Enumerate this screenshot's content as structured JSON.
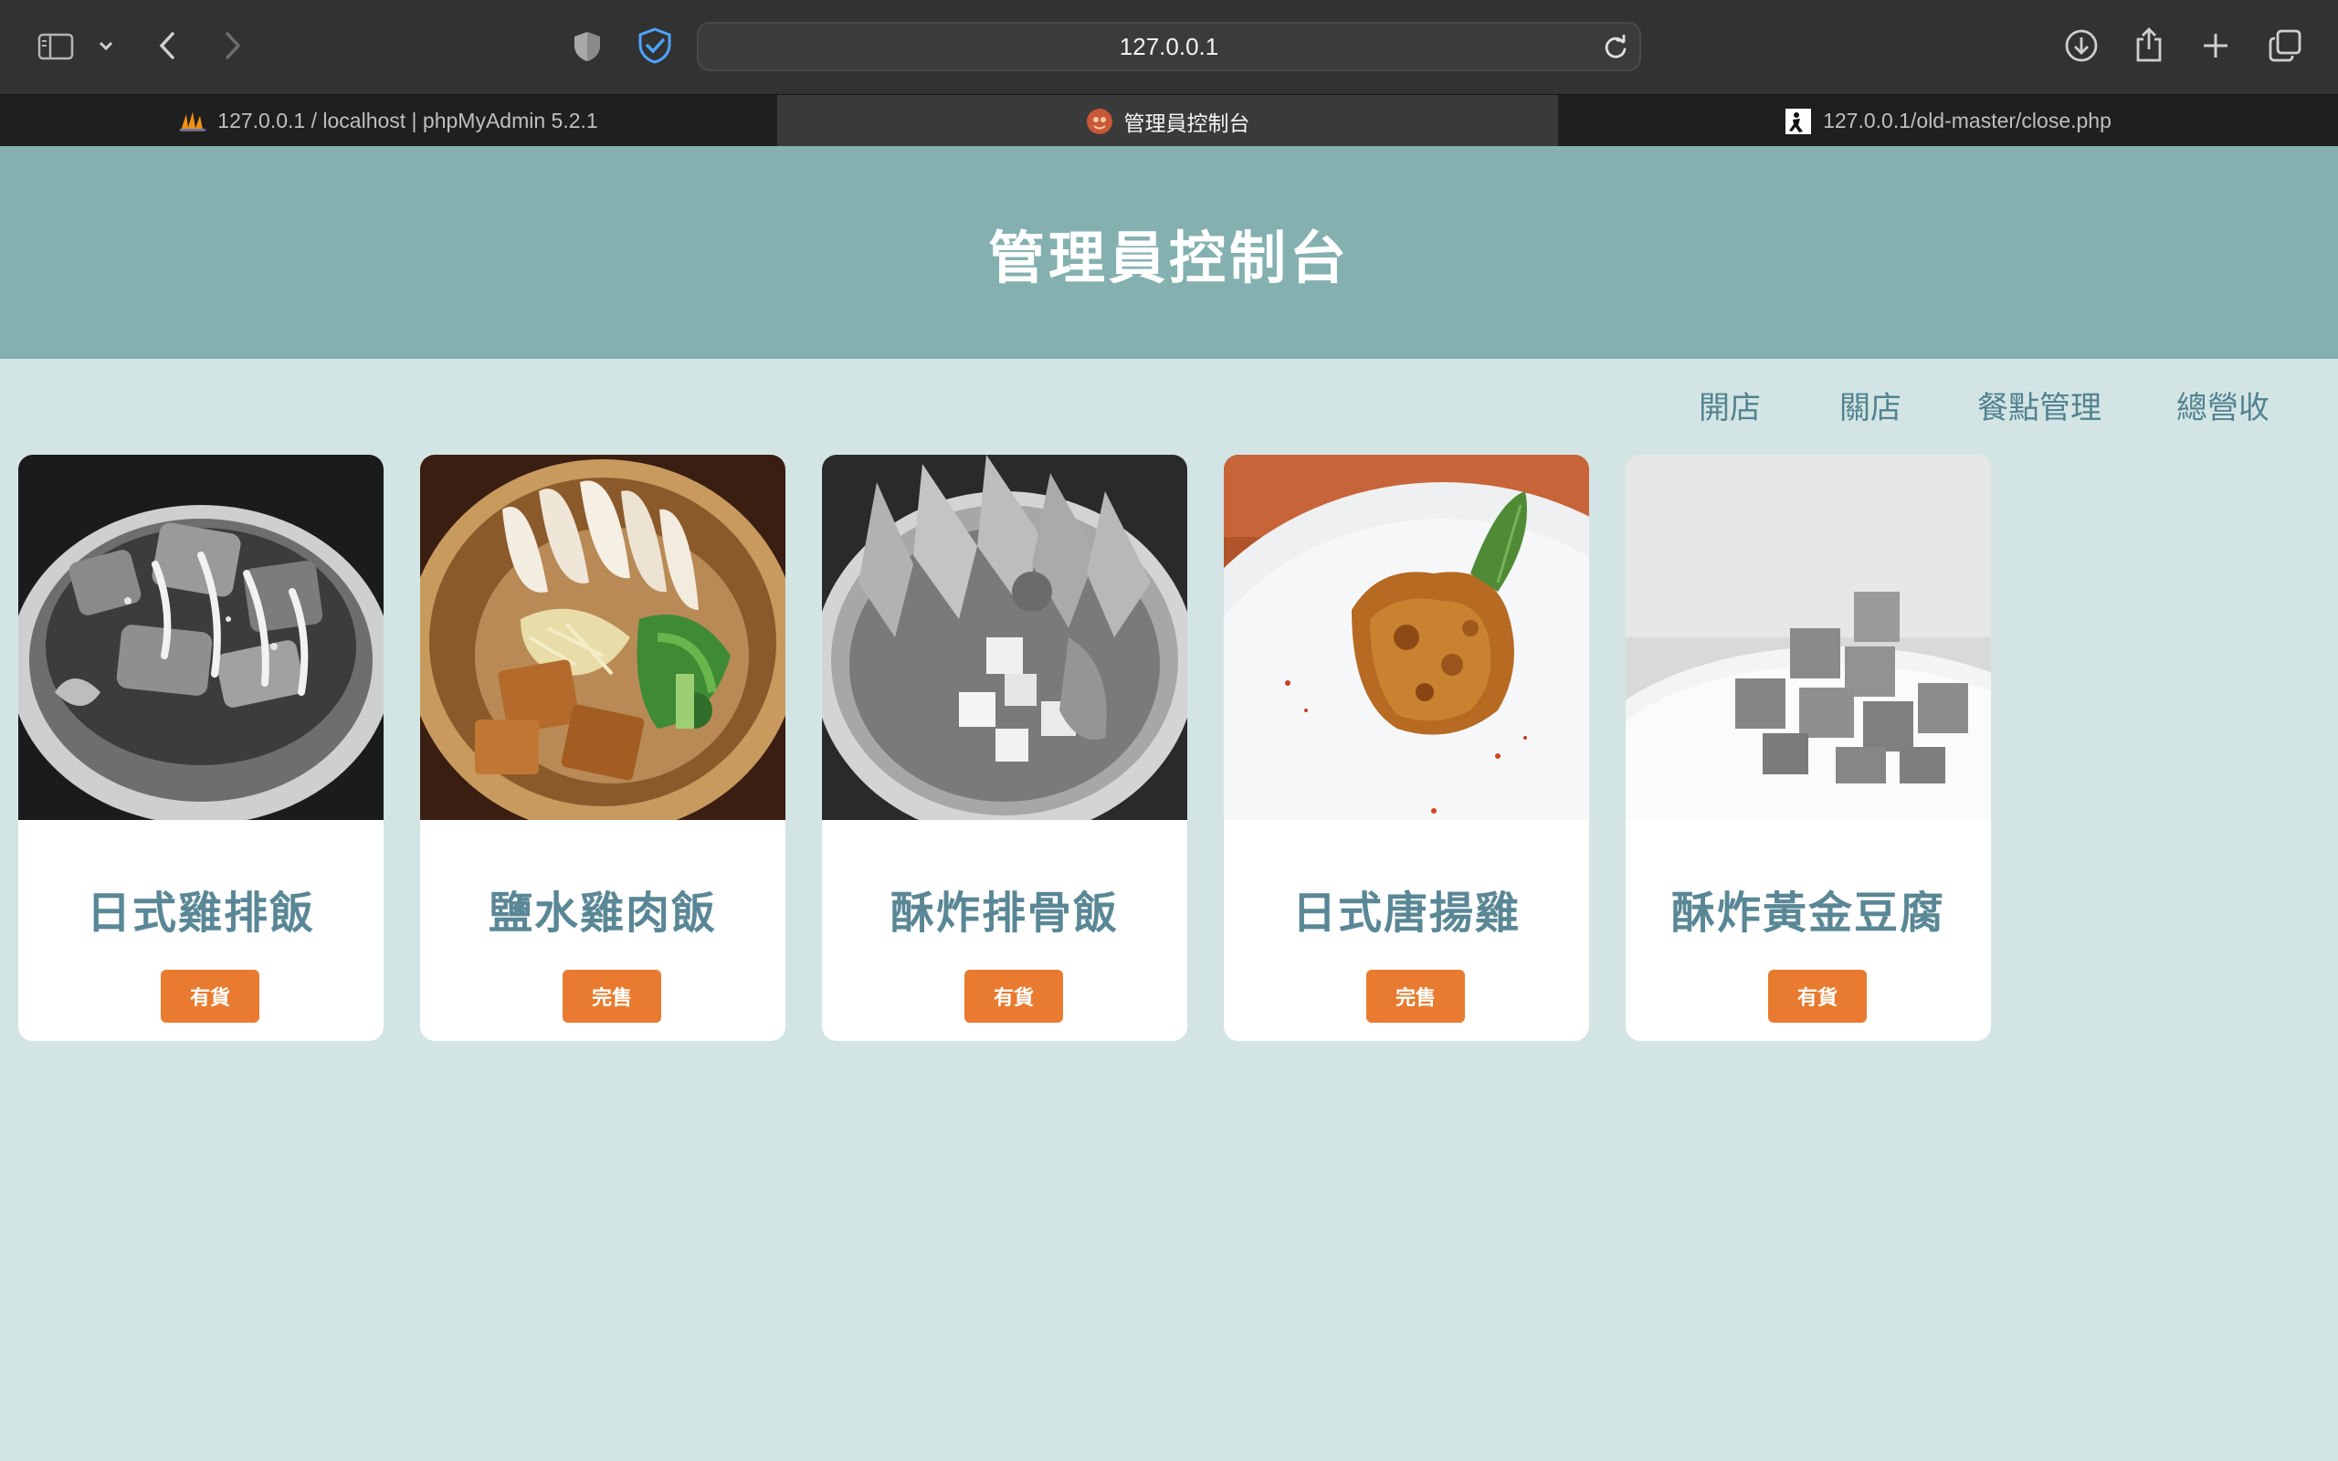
{
  "browser": {
    "address": "127.0.0.1",
    "tabs": [
      {
        "label": "127.0.0.1 / localhost | phpMyAdmin 5.2.1",
        "active": false
      },
      {
        "label": "管理員控制台",
        "active": true
      },
      {
        "label": "127.0.0.1/old-master/close.php",
        "active": false
      }
    ]
  },
  "header": {
    "title": "管理員控制台"
  },
  "nav": {
    "open": "開店",
    "close": "關店",
    "menu_manage": "餐點管理",
    "revenue": "總營收"
  },
  "items": [
    {
      "name": "日式雞排飯",
      "status": "有貨",
      "photo": "chicken-cutlet-rice-bowl",
      "grayscale": true
    },
    {
      "name": "鹽水雞肉飯",
      "status": "完售",
      "photo": "salted-chicken-rice-bowl",
      "grayscale": false
    },
    {
      "name": "酥炸排骨飯",
      "status": "有貨",
      "photo": "fried-pork-chop-rice-bowl",
      "grayscale": true
    },
    {
      "name": "日式唐揚雞",
      "status": "完售",
      "photo": "karaage-fried-chicken",
      "grayscale": false
    },
    {
      "name": "酥炸黃金豆腐",
      "status": "有貨",
      "photo": "fried-golden-tofu",
      "grayscale": true
    }
  ],
  "colors": {
    "header_bg": "#84b1b0",
    "page_bg": "#d2e5e4",
    "accent_text": "#5a8796",
    "button_bg": "#e87b2f"
  }
}
